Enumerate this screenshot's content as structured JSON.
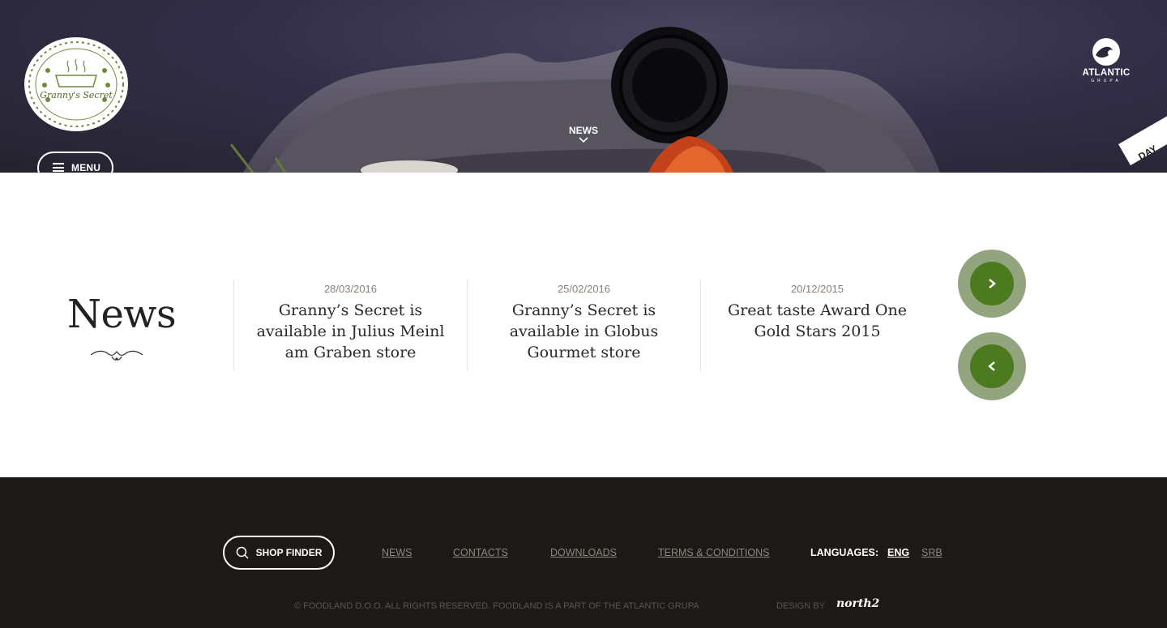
{
  "header": {
    "logo_text": "Granny's Secret",
    "menu_label": "MENU",
    "nav_label": "NEWS",
    "partner_name": "ATLANTIC",
    "partner_sub": "GRUPA",
    "ribbon_text": "DAY"
  },
  "news": {
    "title": "News",
    "items": [
      {
        "date": "28/03/2016",
        "headline": "Granny’s Secret is available in Julius Meinl am Graben store"
      },
      {
        "date": "25/02/2016",
        "headline": "Granny’s Secret is available in Globus Gourmet store"
      },
      {
        "date": "20/12/2015",
        "headline": "Great taste Award One Gold Stars 2015"
      }
    ],
    "next_icon": "chevron-right-icon",
    "prev_icon": "chevron-left-icon"
  },
  "footer": {
    "shop_finder": "SHOP FINDER",
    "links": {
      "news": "NEWS",
      "contacts": "CONTACTS",
      "downloads": "DOWNLOADS",
      "terms": "TERMS & CONDITIONS"
    },
    "languages_label": "LANGUAGES:",
    "lang_eng": "ENG",
    "lang_srb": "SRB",
    "copyright": "© FOODLAND D.O.O. ALL RIGHTS RESERVED. FOODLAND IS A PART OF THE ATLANTIC GRUPA",
    "design_by": "DESIGN BY",
    "designer": "north2"
  },
  "colors": {
    "accent_green": "#4b7a1f",
    "accent_green_light": "#93a57f",
    "footer_bg": "#1c1917"
  }
}
